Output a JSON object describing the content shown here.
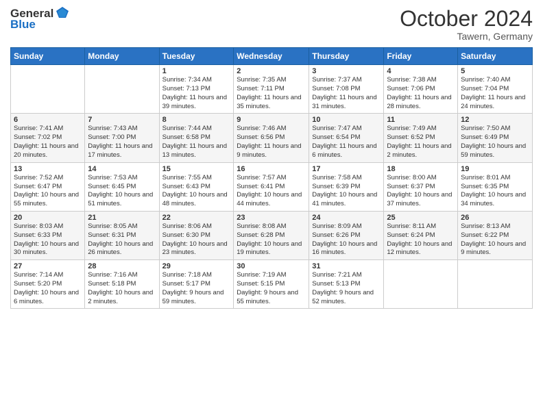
{
  "header": {
    "logo_general": "General",
    "logo_blue": "Blue",
    "month_title": "October 2024",
    "location": "Tawern, Germany"
  },
  "days_of_week": [
    "Sunday",
    "Monday",
    "Tuesday",
    "Wednesday",
    "Thursday",
    "Friday",
    "Saturday"
  ],
  "weeks": [
    [
      {
        "day": "",
        "sunrise": "",
        "sunset": "",
        "daylight": ""
      },
      {
        "day": "",
        "sunrise": "",
        "sunset": "",
        "daylight": ""
      },
      {
        "day": "1",
        "sunrise": "Sunrise: 7:34 AM",
        "sunset": "Sunset: 7:13 PM",
        "daylight": "Daylight: 11 hours and 39 minutes."
      },
      {
        "day": "2",
        "sunrise": "Sunrise: 7:35 AM",
        "sunset": "Sunset: 7:11 PM",
        "daylight": "Daylight: 11 hours and 35 minutes."
      },
      {
        "day": "3",
        "sunrise": "Sunrise: 7:37 AM",
        "sunset": "Sunset: 7:08 PM",
        "daylight": "Daylight: 11 hours and 31 minutes."
      },
      {
        "day": "4",
        "sunrise": "Sunrise: 7:38 AM",
        "sunset": "Sunset: 7:06 PM",
        "daylight": "Daylight: 11 hours and 28 minutes."
      },
      {
        "day": "5",
        "sunrise": "Sunrise: 7:40 AM",
        "sunset": "Sunset: 7:04 PM",
        "daylight": "Daylight: 11 hours and 24 minutes."
      }
    ],
    [
      {
        "day": "6",
        "sunrise": "Sunrise: 7:41 AM",
        "sunset": "Sunset: 7:02 PM",
        "daylight": "Daylight: 11 hours and 20 minutes."
      },
      {
        "day": "7",
        "sunrise": "Sunrise: 7:43 AM",
        "sunset": "Sunset: 7:00 PM",
        "daylight": "Daylight: 11 hours and 17 minutes."
      },
      {
        "day": "8",
        "sunrise": "Sunrise: 7:44 AM",
        "sunset": "Sunset: 6:58 PM",
        "daylight": "Daylight: 11 hours and 13 minutes."
      },
      {
        "day": "9",
        "sunrise": "Sunrise: 7:46 AM",
        "sunset": "Sunset: 6:56 PM",
        "daylight": "Daylight: 11 hours and 9 minutes."
      },
      {
        "day": "10",
        "sunrise": "Sunrise: 7:47 AM",
        "sunset": "Sunset: 6:54 PM",
        "daylight": "Daylight: 11 hours and 6 minutes."
      },
      {
        "day": "11",
        "sunrise": "Sunrise: 7:49 AM",
        "sunset": "Sunset: 6:52 PM",
        "daylight": "Daylight: 11 hours and 2 minutes."
      },
      {
        "day": "12",
        "sunrise": "Sunrise: 7:50 AM",
        "sunset": "Sunset: 6:49 PM",
        "daylight": "Daylight: 10 hours and 59 minutes."
      }
    ],
    [
      {
        "day": "13",
        "sunrise": "Sunrise: 7:52 AM",
        "sunset": "Sunset: 6:47 PM",
        "daylight": "Daylight: 10 hours and 55 minutes."
      },
      {
        "day": "14",
        "sunrise": "Sunrise: 7:53 AM",
        "sunset": "Sunset: 6:45 PM",
        "daylight": "Daylight: 10 hours and 51 minutes."
      },
      {
        "day": "15",
        "sunrise": "Sunrise: 7:55 AM",
        "sunset": "Sunset: 6:43 PM",
        "daylight": "Daylight: 10 hours and 48 minutes."
      },
      {
        "day": "16",
        "sunrise": "Sunrise: 7:57 AM",
        "sunset": "Sunset: 6:41 PM",
        "daylight": "Daylight: 10 hours and 44 minutes."
      },
      {
        "day": "17",
        "sunrise": "Sunrise: 7:58 AM",
        "sunset": "Sunset: 6:39 PM",
        "daylight": "Daylight: 10 hours and 41 minutes."
      },
      {
        "day": "18",
        "sunrise": "Sunrise: 8:00 AM",
        "sunset": "Sunset: 6:37 PM",
        "daylight": "Daylight: 10 hours and 37 minutes."
      },
      {
        "day": "19",
        "sunrise": "Sunrise: 8:01 AM",
        "sunset": "Sunset: 6:35 PM",
        "daylight": "Daylight: 10 hours and 34 minutes."
      }
    ],
    [
      {
        "day": "20",
        "sunrise": "Sunrise: 8:03 AM",
        "sunset": "Sunset: 6:33 PM",
        "daylight": "Daylight: 10 hours and 30 minutes."
      },
      {
        "day": "21",
        "sunrise": "Sunrise: 8:05 AM",
        "sunset": "Sunset: 6:31 PM",
        "daylight": "Daylight: 10 hours and 26 minutes."
      },
      {
        "day": "22",
        "sunrise": "Sunrise: 8:06 AM",
        "sunset": "Sunset: 6:30 PM",
        "daylight": "Daylight: 10 hours and 23 minutes."
      },
      {
        "day": "23",
        "sunrise": "Sunrise: 8:08 AM",
        "sunset": "Sunset: 6:28 PM",
        "daylight": "Daylight: 10 hours and 19 minutes."
      },
      {
        "day": "24",
        "sunrise": "Sunrise: 8:09 AM",
        "sunset": "Sunset: 6:26 PM",
        "daylight": "Daylight: 10 hours and 16 minutes."
      },
      {
        "day": "25",
        "sunrise": "Sunrise: 8:11 AM",
        "sunset": "Sunset: 6:24 PM",
        "daylight": "Daylight: 10 hours and 12 minutes."
      },
      {
        "day": "26",
        "sunrise": "Sunrise: 8:13 AM",
        "sunset": "Sunset: 6:22 PM",
        "daylight": "Daylight: 10 hours and 9 minutes."
      }
    ],
    [
      {
        "day": "27",
        "sunrise": "Sunrise: 7:14 AM",
        "sunset": "Sunset: 5:20 PM",
        "daylight": "Daylight: 10 hours and 6 minutes."
      },
      {
        "day": "28",
        "sunrise": "Sunrise: 7:16 AM",
        "sunset": "Sunset: 5:18 PM",
        "daylight": "Daylight: 10 hours and 2 minutes."
      },
      {
        "day": "29",
        "sunrise": "Sunrise: 7:18 AM",
        "sunset": "Sunset: 5:17 PM",
        "daylight": "Daylight: 9 hours and 59 minutes."
      },
      {
        "day": "30",
        "sunrise": "Sunrise: 7:19 AM",
        "sunset": "Sunset: 5:15 PM",
        "daylight": "Daylight: 9 hours and 55 minutes."
      },
      {
        "day": "31",
        "sunrise": "Sunrise: 7:21 AM",
        "sunset": "Sunset: 5:13 PM",
        "daylight": "Daylight: 9 hours and 52 minutes."
      },
      {
        "day": "",
        "sunrise": "",
        "sunset": "",
        "daylight": ""
      },
      {
        "day": "",
        "sunrise": "",
        "sunset": "",
        "daylight": ""
      }
    ]
  ]
}
